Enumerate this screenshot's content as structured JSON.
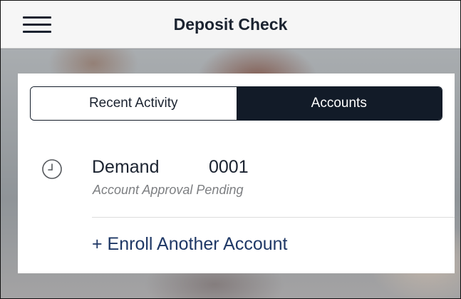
{
  "header": {
    "title": "Deposit Check",
    "menu_icon": "hamburger-menu-icon"
  },
  "tabs": [
    {
      "label": "Recent Activity",
      "selected": false
    },
    {
      "label": "Accounts",
      "selected": true
    }
  ],
  "accounts": [
    {
      "name": "Demand",
      "number": "0001",
      "status": "Account Approval Pending",
      "icon": "clock-icon"
    }
  ],
  "enroll_label": "+ Enroll Another Account",
  "colors": {
    "navy": "#121b28",
    "link": "#1f3866",
    "muted": "#7d7f82"
  }
}
